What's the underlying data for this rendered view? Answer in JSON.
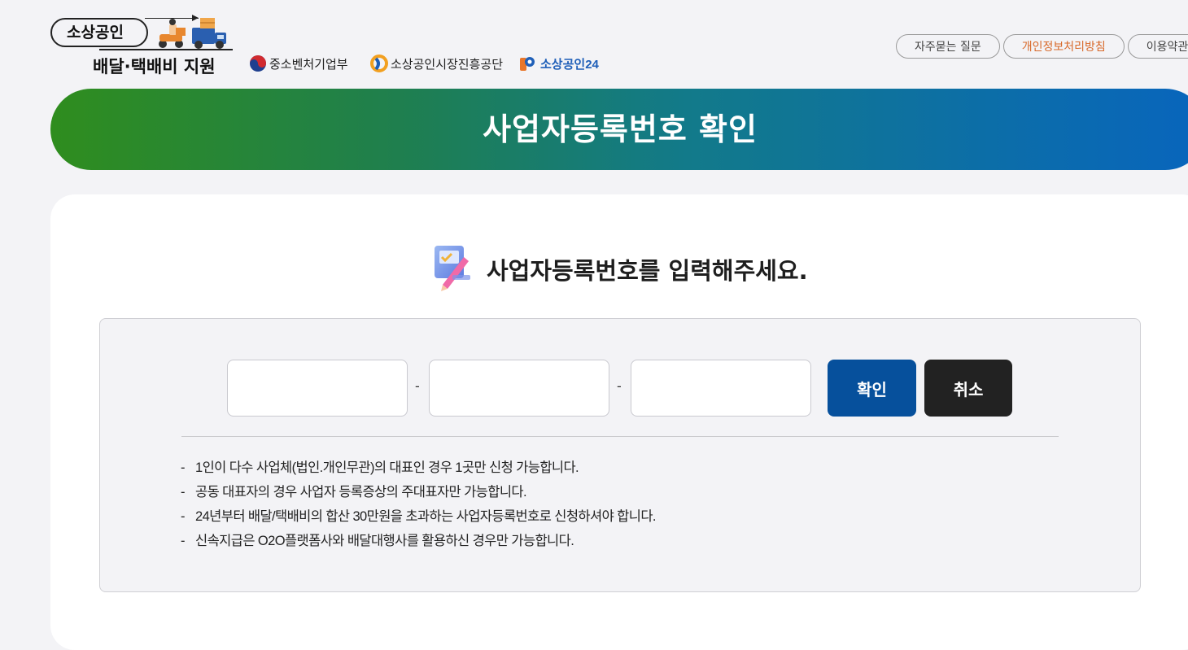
{
  "header": {
    "logo": {
      "pill_text": "소상공인",
      "subtitle": "배달·택배비 지원"
    },
    "orgs": [
      {
        "label": "중소벤처기업부",
        "icon": "taegeuk-icon"
      },
      {
        "label": "소상공인시장진흥공단",
        "icon": "semas-logo-icon"
      },
      {
        "label": "소상공인24",
        "icon": "p24-logo-icon"
      }
    ],
    "links": [
      {
        "label": "자주묻는 질문"
      },
      {
        "label": "개인정보처리방침"
      },
      {
        "label": "이용약관"
      }
    ]
  },
  "banner": {
    "title": "사업자등록번호 확인"
  },
  "form": {
    "heading": "사업자등록번호를 입력해주세요.",
    "separator": "-",
    "fields": [
      {
        "value": "",
        "placeholder": ""
      },
      {
        "value": "",
        "placeholder": ""
      },
      {
        "value": "",
        "placeholder": ""
      }
    ],
    "confirm_label": "확인",
    "cancel_label": "취소",
    "notes": [
      "1인이 다수 사업체(법인.개인무관)의 대표인 경우 1곳만 신청 가능합니다.",
      "공동 대표자의 경우 사업자 등록증상의 주대표자만 가능합니다.",
      "24년부터 배달/택배비의 합산 30만원을 초과하는 사업자등록번호로 신청하셔야 합니다.",
      "신속지급은 O2O플랫폼사와 배달대행사를 활용하신 경우만 가능합니다."
    ],
    "note_dash": "-"
  },
  "colors": {
    "banner_start": "#2f8d1e",
    "banner_end": "#0865bd",
    "confirm_button": "#06509c",
    "cancel_button": "#222222",
    "accent_link": "#d8692a"
  }
}
